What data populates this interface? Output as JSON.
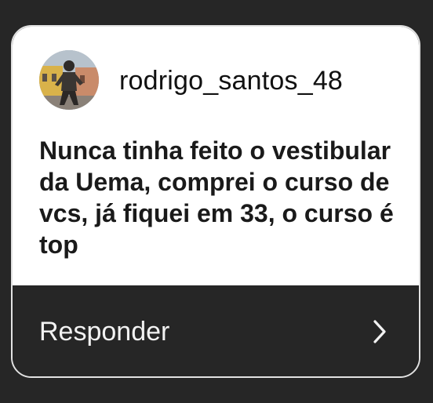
{
  "comment": {
    "username": "rodrigo_santos_48",
    "message": "Nunca tinha feito o vestibular da Uema, comprei o curso de vcs, já fiquei em 33, o curso é top"
  },
  "reply": {
    "label": "Responder",
    "icon": "chevron-right-icon"
  },
  "colors": {
    "background": "#262626",
    "card_top": "#ffffff",
    "border": "#e2e2e2",
    "text_dark": "#1a1a1a",
    "text_light": "#f2f2f2"
  }
}
